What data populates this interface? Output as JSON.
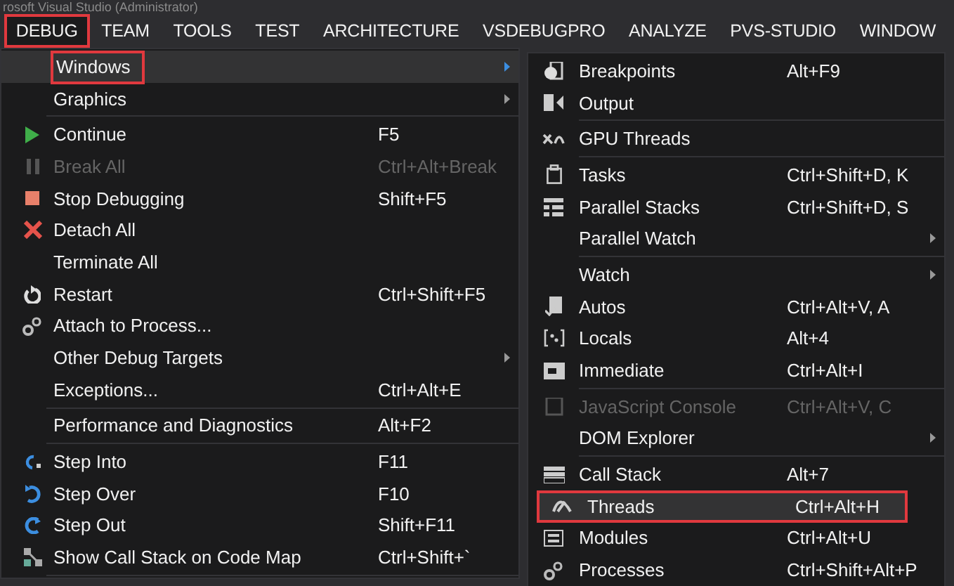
{
  "window": {
    "title": "rosoft Visual Studio (Administrator)"
  },
  "menu_bar": {
    "items": [
      {
        "label": "DEBUG",
        "selected": true,
        "annotated": true
      },
      {
        "label": "TEAM",
        "selected": false,
        "annotated": false
      },
      {
        "label": "TOOLS",
        "selected": false,
        "annotated": false
      },
      {
        "label": "TEST",
        "selected": false,
        "annotated": false
      },
      {
        "label": "ARCHITECTURE",
        "selected": false,
        "annotated": false
      },
      {
        "label": "VSDEBUGPRO",
        "selected": false,
        "annotated": false
      },
      {
        "label": "ANALYZE",
        "selected": false,
        "annotated": false
      },
      {
        "label": "PVS-STUDIO",
        "selected": false,
        "annotated": false
      },
      {
        "label": "WINDOW",
        "selected": false,
        "annotated": false
      }
    ]
  },
  "debug_menu": {
    "items": [
      {
        "kind": "item",
        "label": "Windows",
        "submenu": true,
        "disabled": false,
        "selected": true,
        "annotated": true
      },
      {
        "kind": "item",
        "label": "Graphics",
        "submenu": true,
        "disabled": false,
        "selected": false,
        "annotated": false
      },
      {
        "kind": "separator"
      },
      {
        "kind": "item",
        "label": "Continue",
        "shortcut": "F5",
        "submenu": false,
        "disabled": false,
        "selected": false,
        "annotated": false
      },
      {
        "kind": "item",
        "label": "Break All",
        "shortcut": "Ctrl+Alt+Break",
        "submenu": false,
        "disabled": true,
        "selected": false,
        "annotated": false
      },
      {
        "kind": "item",
        "label": "Stop Debugging",
        "shortcut": "Shift+F5",
        "submenu": false,
        "disabled": false,
        "selected": false,
        "annotated": false
      },
      {
        "kind": "item",
        "label": "Detach All",
        "submenu": false,
        "disabled": false,
        "selected": false,
        "annotated": false
      },
      {
        "kind": "item",
        "label": "Terminate All",
        "submenu": false,
        "disabled": false,
        "selected": false,
        "annotated": false
      },
      {
        "kind": "item",
        "label": "Restart",
        "shortcut": "Ctrl+Shift+F5",
        "submenu": false,
        "disabled": false,
        "selected": false,
        "annotated": false
      },
      {
        "kind": "item",
        "label": "Attach to Process...",
        "submenu": false,
        "disabled": false,
        "selected": false,
        "annotated": false
      },
      {
        "kind": "item",
        "label": "Other Debug Targets",
        "submenu": true,
        "disabled": false,
        "selected": false,
        "annotated": false
      },
      {
        "kind": "item",
        "label": "Exceptions...",
        "shortcut": "Ctrl+Alt+E",
        "submenu": false,
        "disabled": false,
        "selected": false,
        "annotated": false
      },
      {
        "kind": "separator"
      },
      {
        "kind": "item",
        "label": "Performance and Diagnostics",
        "shortcut": "Alt+F2",
        "submenu": false,
        "disabled": false,
        "selected": false,
        "annotated": false
      },
      {
        "kind": "separator"
      },
      {
        "kind": "item",
        "label": "Step Into",
        "shortcut": "F11",
        "submenu": false,
        "disabled": false,
        "selected": false,
        "annotated": false
      },
      {
        "kind": "item",
        "label": "Step Over",
        "shortcut": "F10",
        "submenu": false,
        "disabled": false,
        "selected": false,
        "annotated": false
      },
      {
        "kind": "item",
        "label": "Step Out",
        "shortcut": "Shift+F11",
        "submenu": false,
        "disabled": false,
        "selected": false,
        "annotated": false
      },
      {
        "kind": "item",
        "label": "Show Call Stack on Code Map",
        "shortcut": "Ctrl+Shift+`",
        "submenu": false,
        "disabled": false,
        "selected": false,
        "annotated": false
      },
      {
        "kind": "separator"
      }
    ]
  },
  "windows_submenu": {
    "items": [
      {
        "kind": "item",
        "label": "Breakpoints",
        "shortcut": "Alt+F9",
        "submenu": false,
        "disabled": false,
        "selected": false,
        "annotated": false
      },
      {
        "kind": "item",
        "label": "Output",
        "submenu": false,
        "disabled": false,
        "selected": false,
        "annotated": false
      },
      {
        "kind": "separator"
      },
      {
        "kind": "item",
        "label": "GPU Threads",
        "submenu": false,
        "disabled": false,
        "selected": false,
        "annotated": false
      },
      {
        "kind": "separator"
      },
      {
        "kind": "item",
        "label": "Tasks",
        "shortcut": "Ctrl+Shift+D, K",
        "submenu": false,
        "disabled": false,
        "selected": false,
        "annotated": false
      },
      {
        "kind": "item",
        "label": "Parallel Stacks",
        "shortcut": "Ctrl+Shift+D, S",
        "submenu": false,
        "disabled": false,
        "selected": false,
        "annotated": false
      },
      {
        "kind": "item",
        "label": "Parallel Watch",
        "submenu": true,
        "disabled": false,
        "selected": false,
        "annotated": false
      },
      {
        "kind": "separator"
      },
      {
        "kind": "item",
        "label": "Watch",
        "submenu": true,
        "disabled": false,
        "selected": false,
        "annotated": false
      },
      {
        "kind": "item",
        "label": "Autos",
        "shortcut": "Ctrl+Alt+V, A",
        "submenu": false,
        "disabled": false,
        "selected": false,
        "annotated": false
      },
      {
        "kind": "item",
        "label": "Locals",
        "shortcut": "Alt+4",
        "submenu": false,
        "disabled": false,
        "selected": false,
        "annotated": false
      },
      {
        "kind": "item",
        "label": "Immediate",
        "shortcut": "Ctrl+Alt+I",
        "submenu": false,
        "disabled": false,
        "selected": false,
        "annotated": false
      },
      {
        "kind": "separator"
      },
      {
        "kind": "item",
        "label": "JavaScript Console",
        "shortcut": "Ctrl+Alt+V, C",
        "submenu": false,
        "disabled": true,
        "selected": false,
        "annotated": false
      },
      {
        "kind": "item",
        "label": "DOM Explorer",
        "submenu": true,
        "disabled": false,
        "selected": false,
        "annotated": false
      },
      {
        "kind": "separator"
      },
      {
        "kind": "item",
        "label": "Call Stack",
        "shortcut": "Alt+7",
        "submenu": false,
        "disabled": false,
        "selected": false,
        "annotated": false
      },
      {
        "kind": "item",
        "label": "Threads",
        "shortcut": "Ctrl+Alt+H",
        "submenu": false,
        "disabled": false,
        "selected": true,
        "annotated": true
      },
      {
        "kind": "item",
        "label": "Modules",
        "shortcut": "Ctrl+Alt+U",
        "submenu": false,
        "disabled": false,
        "selected": false,
        "annotated": false
      },
      {
        "kind": "item",
        "label": "Processes",
        "shortcut": "Ctrl+Shift+Alt+P",
        "submenu": false,
        "disabled": false,
        "selected": false,
        "annotated": false
      }
    ]
  }
}
